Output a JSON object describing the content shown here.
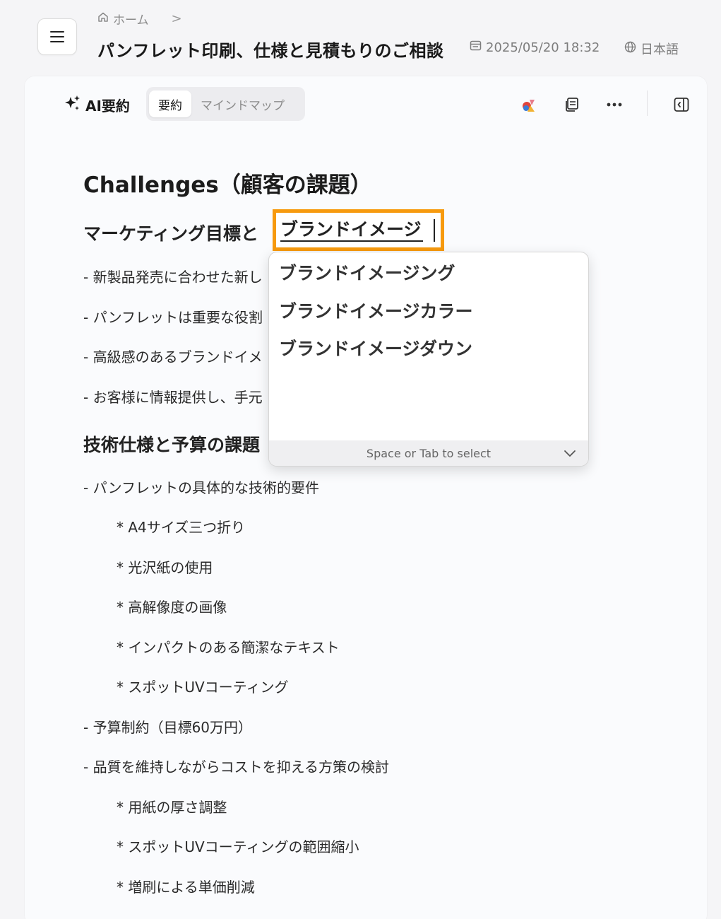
{
  "header": {
    "breadcrumb_home": "ホーム",
    "breadcrumb_sep": ">",
    "title": "パンフレット印刷、仕様と見積もりのご相談",
    "date": "2025/05/20 18:32",
    "language": "日本語"
  },
  "toolbar": {
    "ai_label": "AI要約",
    "tabs": [
      {
        "label": "要約"
      },
      {
        "label": "マインドマップ"
      }
    ]
  },
  "content": {
    "heading": "Challenges（顧客の課題）",
    "section1_title_prefix": "マーケティング目標と",
    "section1_bullets": [
      "- 新製品発売に合わせた新し",
      "- パンフレットは重要な役割",
      "- 高級感のあるブランドイメ",
      "- お客様に情報提供し、手元"
    ],
    "section2_title": "技術仕様と予算の課題",
    "b1": "- パンフレットの具体的な技術的要件",
    "b1_sub": [
      "* A4サイズ三つ折り",
      "* 光沢紙の使用",
      "* 高解像度の画像",
      "* インパクトのある簡潔なテキスト",
      "* スポットUVコーティング"
    ],
    "b2": "- 予算制約（目標60万円）",
    "b3": "- 品質を維持しながらコストを抑える方策の検討",
    "b3_sub": [
      "* 用紙の厚さ調整",
      "* スポットUVコーティングの範囲縮小",
      "* 増刷による単価削減"
    ]
  },
  "ime": {
    "composing_text": "ブランドイメージ",
    "candidates": [
      "ブランドイメージング",
      "ブランドイメージカラー",
      "ブランドイメージダウン"
    ],
    "footer_hint": "Space or Tab to select"
  },
  "colors": {
    "highlight_border": "#f79a0e",
    "background": "#f5f5f7",
    "card": "#fafbfd"
  }
}
